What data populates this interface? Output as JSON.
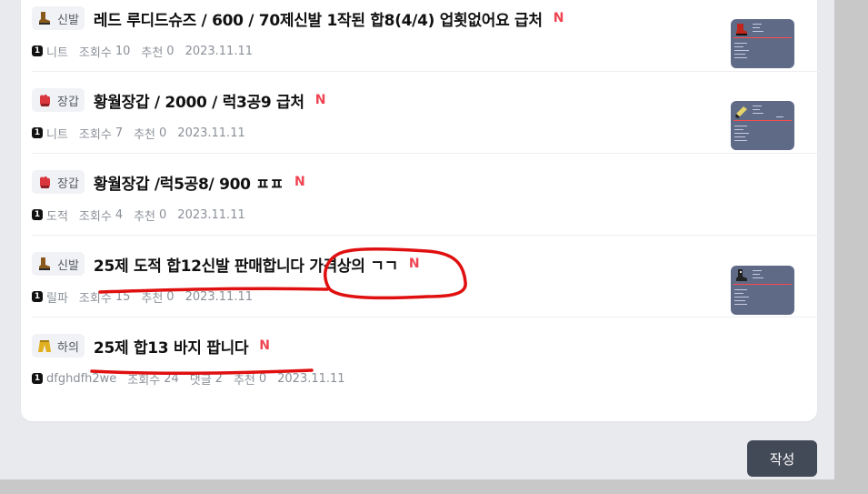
{
  "posts": [
    {
      "category": "신발",
      "category_icon": "boot-icon",
      "title": "레드 루디드슈즈 / 600 / 70제신발 1작된 합8(4/4) 업횟없어요 급처",
      "new_badge": "N",
      "level": "1",
      "author": "니트",
      "views_label": "조회수",
      "views": "10",
      "likes_label": "추천",
      "likes": "0",
      "date": "2023.11.11",
      "has_thumbnail": true
    },
    {
      "category": "장갑",
      "category_icon": "glove-icon",
      "title": "황월장갑 / 2000 / 럭3공9 급처",
      "new_badge": "N",
      "level": "1",
      "author": "니트",
      "views_label": "조회수",
      "views": "7",
      "likes_label": "추천",
      "likes": "0",
      "date": "2023.11.11",
      "has_thumbnail": true
    },
    {
      "category": "장갑",
      "category_icon": "glove-icon",
      "title": "황월장갑 /럭5공8/ 900 ㅍㅍ",
      "new_badge": "N",
      "level": "1",
      "author": "도적",
      "views_label": "조회수",
      "views": "4",
      "likes_label": "추천",
      "likes": "0",
      "date": "2023.11.11",
      "has_thumbnail": false
    },
    {
      "category": "신발",
      "category_icon": "boot-icon",
      "title": "25제 도적 합12신발 판매합니다 가격상의 ㄱㄱ",
      "new_badge": "N",
      "level": "1",
      "author": "릴파",
      "views_label": "조회수",
      "views": "15",
      "likes_label": "추천",
      "likes": "0",
      "date": "2023.11.11",
      "has_thumbnail": true
    },
    {
      "category": "하의",
      "category_icon": "pants-icon",
      "title": "25제 합13 바지 팝니다",
      "new_badge": "N",
      "level": "1",
      "author": "dfghdfh2we",
      "views_label": "조회수",
      "views": "24",
      "comments_label": "댓글",
      "comments": "2",
      "likes_label": "추천",
      "likes": "0",
      "date": "2023.11.11",
      "has_thumbnail": false
    }
  ],
  "write_button": "작성",
  "colors": {
    "new_badge": "#f04452",
    "annotation": "#e01010",
    "button_bg": "#434a57",
    "thumbnail_bg": "#5f6a86"
  }
}
